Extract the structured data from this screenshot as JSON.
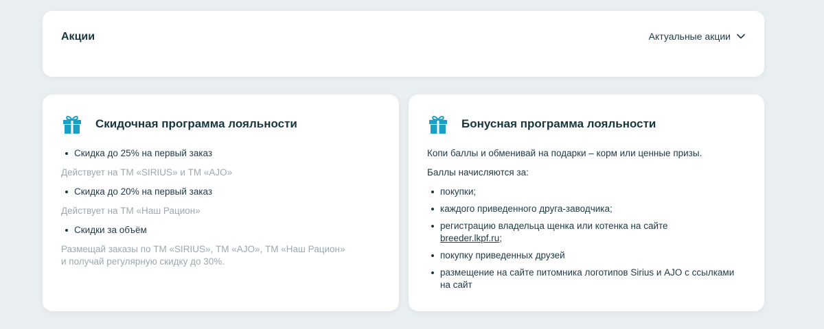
{
  "header": {
    "title": "Акции",
    "filter_label": "Актуальные акции",
    "filter_icon": "chevron-down-icon"
  },
  "colors": {
    "background": "#e9eef1",
    "card": "#ffffff",
    "accent": "#1aa0c4",
    "text": "#1d3a44",
    "muted": "#9aa9ae"
  },
  "discount_program": {
    "icon": "gift-icon",
    "title": "Скидочная программа лояльности",
    "items": [
      {
        "label": "Скидка до 25% на первый заказ",
        "note": "Действует на ТМ «SIRIUS» и ТМ «AJO»"
      },
      {
        "label": "Скидка до 20% на первый заказ",
        "note": "Действует на ТМ «Наш Рацион»"
      },
      {
        "label": "Скидки за объём",
        "note_line1": "Размещай заказы по ТМ «SIRIUS», ТМ «AJO», ТМ «Наш Рацион»",
        "note_line2": "и получай регулярную скидку до 30%."
      }
    ]
  },
  "bonus_program": {
    "icon": "gift-icon",
    "title": "Бонусная программа лояльности",
    "intro": "Копи баллы и обменивай на подарки – корм или ценные призы.",
    "accrual_heading": "Баллы начисляются за:",
    "items": [
      "покупки;",
      "каждого приведенного друга-заводчика;",
      "регистрацию владельца щенка или котенка на сайте",
      "покупку приведенных друзей",
      "размещение на сайте питомника логотипов Sirius и AJO с ссылками на сайт"
    ],
    "registration_link": "breeder.lkpf.ru",
    "registration_link_suffix": ";"
  }
}
